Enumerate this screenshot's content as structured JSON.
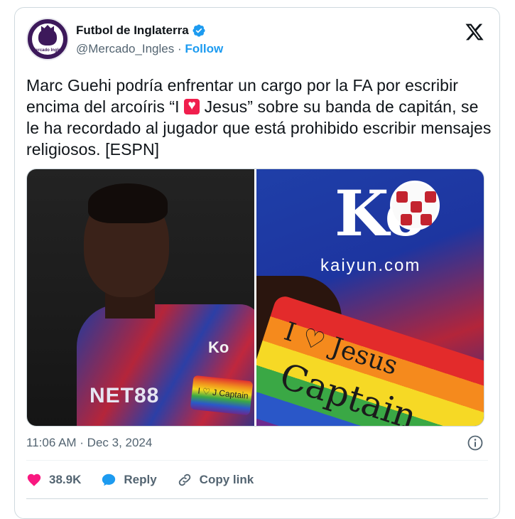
{
  "author": {
    "display_name": "Futbol de Inglaterra",
    "handle": "@Mercado_Ingles",
    "separator": "·",
    "follow_label": "Follow",
    "avatar_text": "Mercado Ingles"
  },
  "tweet": {
    "text_before_emoji": "Marc Guehi podría enfrentar un cargo por la FA por escribir encima del arcoíris “I ",
    "text_after_emoji": " Jesus” sobre su banda de capitán, se le ha recordado al jugador que está prohibido escribir mensajes religiosos. [ESPN]",
    "emoji": "heart-emoji"
  },
  "media": {
    "left_photo": {
      "sponsor": "NET88",
      "chest_logo": "Ko",
      "armband_text": "I ♡ J Captain"
    },
    "right_photo": {
      "logo": "Ko",
      "sponsor": "kaiyun.com",
      "armband_line1": "I ♡ Jesus",
      "armband_line2": "Captain"
    }
  },
  "footer": {
    "timestamp": "11:06 AM · Dec 3, 2024",
    "likes": "38.9K",
    "reply_label": "Reply",
    "copy_link_label": "Copy link"
  },
  "colors": {
    "accent": "#1d9bf0",
    "like": "#f91880",
    "muted": "#536471",
    "text": "#0f1419"
  }
}
